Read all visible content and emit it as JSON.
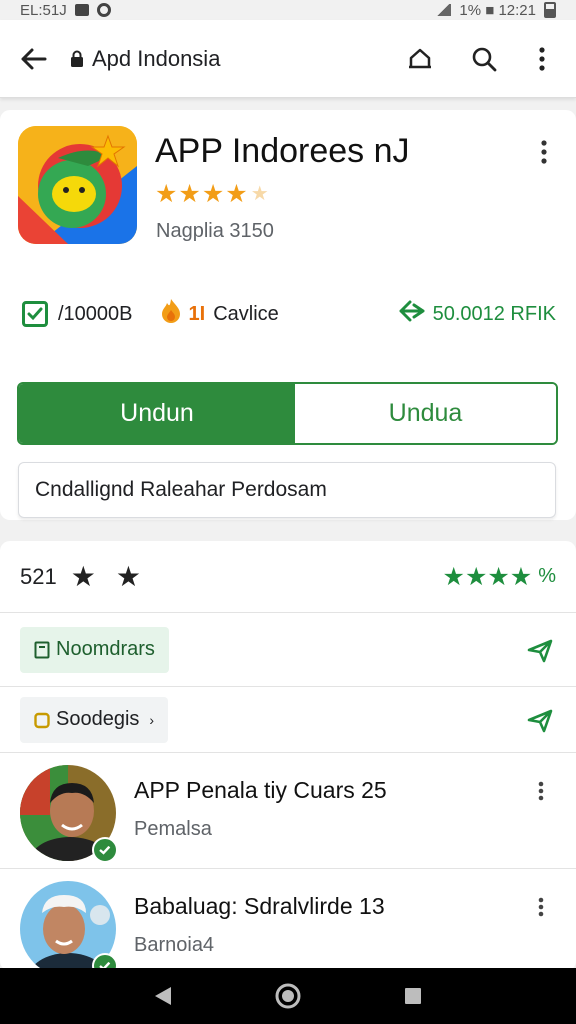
{
  "status_bar": {
    "time": "EL:51J",
    "right_text": "1% ■ 12:21"
  },
  "app_bar": {
    "title": "Apd Indonsia"
  },
  "app": {
    "name": "APP Indorees nJ",
    "rating_stars": 4,
    "developer": "Nagplia 3150",
    "stats": {
      "downloads": "/10000B",
      "fire_count": "1I",
      "fire_label": "Cavlice",
      "rating_count": "50.0012 RFIK"
    },
    "primary_button": "Undun",
    "secondary_button": "Undua",
    "release_note": "Cndallignd Raleahar Perdosam"
  },
  "reviews": {
    "score": "521",
    "right_pct": "%",
    "chips": [
      {
        "label": "Noomdrars"
      },
      {
        "label": "Soodegis"
      }
    ],
    "items": [
      {
        "title": "APP Penala tiy Cuars 25",
        "subtitle": "Pemalsa"
      },
      {
        "title": "Babaluag: Sdralvlirde 13",
        "subtitle": "Barnoia4"
      }
    ]
  },
  "colors": {
    "accent_green": "#2e8b3d",
    "star_orange": "#f29d17"
  }
}
